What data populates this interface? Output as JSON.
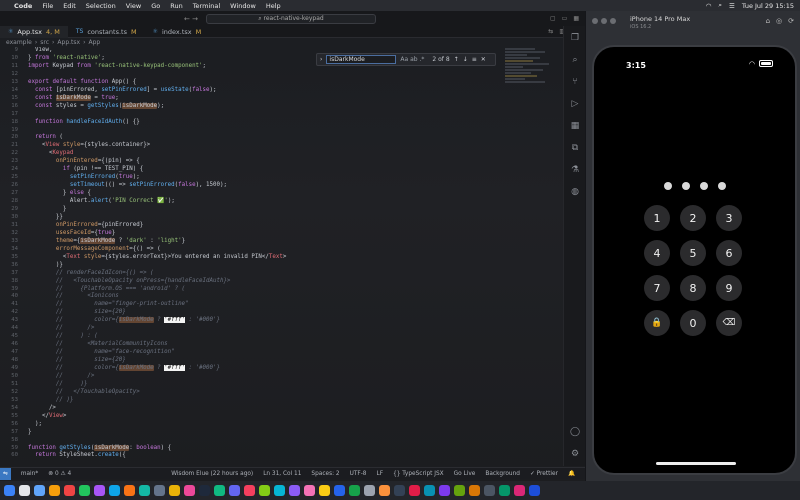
{
  "menubar": {
    "app": "Code",
    "items": [
      "File",
      "Edit",
      "Selection",
      "View",
      "Go",
      "Run",
      "Terminal",
      "Window",
      "Help"
    ],
    "clock": "Tue Jul 29  15:15"
  },
  "titlebar": {
    "search": "react-native-keypad"
  },
  "tabs": [
    {
      "label": "App.tsx",
      "badge": "4, M"
    },
    {
      "label": "constants.ts",
      "badge": "M"
    },
    {
      "label": "index.tsx",
      "badge": "M"
    }
  ],
  "breadcrumb": [
    "example",
    "src",
    "App.tsx",
    "App"
  ],
  "find": {
    "query": "isDarkMode",
    "options": "Aa  ab  .*",
    "count": "2 of 8"
  },
  "lines": [
    {
      "n": "9",
      "text": "  View,"
    },
    {
      "n": "10",
      "text": "} from 'react-native';"
    },
    {
      "n": "11",
      "text": "import Keypad from 'react-native-keypad-component';"
    },
    {
      "n": "12",
      "text": ""
    },
    {
      "n": "13",
      "text": "export default function App() {"
    },
    {
      "n": "14",
      "text": "  const [pinErrored, setPinErrored] = useState(false);"
    },
    {
      "n": "15",
      "text": "  const isDarkMode = true;"
    },
    {
      "n": "16",
      "text": "  const styles = getStyles(isDarkMode);"
    },
    {
      "n": "17",
      "text": ""
    },
    {
      "n": "18",
      "text": "  function handleFaceIdAuth() {}"
    },
    {
      "n": "19",
      "text": ""
    },
    {
      "n": "20",
      "text": "  return ("
    },
    {
      "n": "21",
      "text": "    <View style={styles.container}>"
    },
    {
      "n": "22",
      "text": "      <Keypad"
    },
    {
      "n": "23",
      "text": "        onPinEntered={(pin) => {"
    },
    {
      "n": "24",
      "text": "          if (pin !== TEST_PIN) {"
    },
    {
      "n": "25",
      "text": "            setPinErrored(true);"
    },
    {
      "n": "26",
      "text": "            setTimeout(() => setPinErrored(false), 1500);"
    },
    {
      "n": "27",
      "text": "          } else {"
    },
    {
      "n": "28",
      "text": "            Alert.alert('PIN Correct ✅');"
    },
    {
      "n": "29",
      "text": "          }"
    },
    {
      "n": "30",
      "text": "        }}"
    },
    {
      "n": "31",
      "text": "        onPinErrored={pinErrored}"
    },
    {
      "n": "32",
      "text": "        usesFaceId={true}"
    },
    {
      "n": "33",
      "text": "        theme={isDarkMode ? 'dark' : 'light'}"
    },
    {
      "n": "34",
      "text": "        errorMessageComponent={() => ("
    },
    {
      "n": "35",
      "text": "          <Text style={styles.errorText}>You entered an invalid PIN</Text>"
    },
    {
      "n": "36",
      "text": "        )}"
    },
    {
      "n": "37",
      "text": "        // renderFaceIdIcon={() => ("
    },
    {
      "n": "38",
      "text": "        //   <TouchableOpacity onPress={handleFaceIdAuth}>"
    },
    {
      "n": "39",
      "text": "        //     {Platform.OS === 'android' ? ("
    },
    {
      "n": "40",
      "text": "        //       <Ionicons"
    },
    {
      "n": "41",
      "text": "        //         name=\"finger-print-outline\""
    },
    {
      "n": "42",
      "text": "        //         size={20}"
    },
    {
      "n": "43",
      "text": "        //         color={isDarkMode ? '#fff' : '#000'}"
    },
    {
      "n": "44",
      "text": "        //       />"
    },
    {
      "n": "45",
      "text": "        //     ) : ("
    },
    {
      "n": "46",
      "text": "        //       <MaterialCommunityIcons"
    },
    {
      "n": "47",
      "text": "        //         name=\"face-recognition\""
    },
    {
      "n": "48",
      "text": "        //         size={20}"
    },
    {
      "n": "49",
      "text": "        //         color={isDarkMode ? '#fff' : '#000'}"
    },
    {
      "n": "50",
      "text": "        //       />"
    },
    {
      "n": "51",
      "text": "        //     )}"
    },
    {
      "n": "52",
      "text": "        //   </TouchableOpacity>"
    },
    {
      "n": "53",
      "text": "        // )}"
    },
    {
      "n": "54",
      "text": "      />"
    },
    {
      "n": "55",
      "text": "    </View>"
    },
    {
      "n": "56",
      "text": "  );"
    },
    {
      "n": "57",
      "text": "}"
    },
    {
      "n": "58",
      "text": ""
    },
    {
      "n": "59",
      "text": "function getStyles(isDarkMode: boolean) {"
    },
    {
      "n": "60",
      "text": "  return StyleSheet.create({"
    }
  ],
  "statusbar": {
    "branch": "main*",
    "problems": "⊗ 0  ⚠ 4",
    "blame": "Wisdom Elue (22 hours ago)",
    "cursor": "Ln 31, Col 11",
    "spaces": "Spaces: 2",
    "encoding": "UTF-8",
    "eol": "LF",
    "language": "{} TypeScript JSX",
    "golive": "Go Live",
    "background": "Background",
    "prettier": "✓ Prettier"
  },
  "simulator": {
    "device": "iPhone 14 Pro Max",
    "os": "iOS 16.2",
    "time": "3:15",
    "keys": [
      "1",
      "2",
      "3",
      "4",
      "5",
      "6",
      "7",
      "8",
      "9",
      "",
      "0",
      ""
    ]
  }
}
